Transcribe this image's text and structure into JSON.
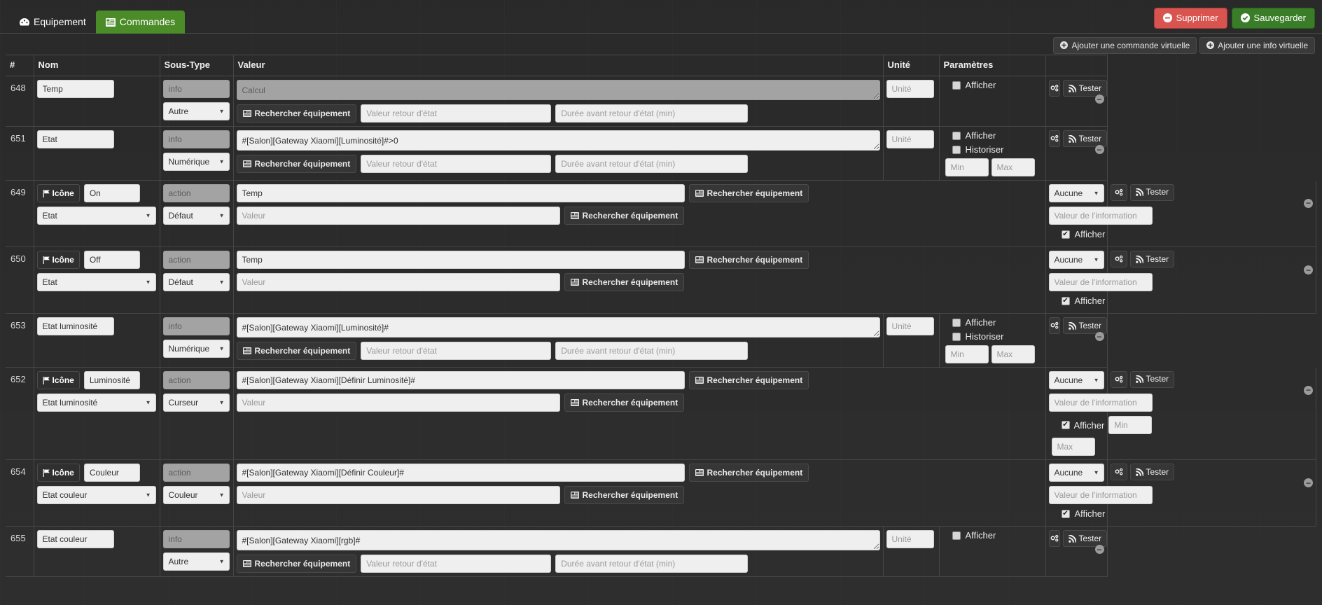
{
  "tabs": [
    {
      "label": "Equipement",
      "icon": "dashboard-icon",
      "active": false
    },
    {
      "label": "Commandes",
      "icon": "list-icon",
      "active": true
    }
  ],
  "toolbar": {
    "delete_label": "Supprimer",
    "save_label": "Sauvegarder",
    "add_virtual_command_label": "Ajouter une commande virtuelle",
    "add_virtual_info_label": "Ajouter une info virtuelle"
  },
  "table": {
    "headers": {
      "id": "#",
      "name": "Nom",
      "subtype": "Sous-Type",
      "value": "Valeur",
      "unit": "Unité",
      "params": "Paramètres",
      "actions": ""
    },
    "common": {
      "search_equipment": "Rechercher équipement",
      "icon_button": "Icône",
      "test_label": "Tester",
      "afficher": "Afficher",
      "historiser": "Historiser",
      "placeholder_unite": "Unité",
      "placeholder_min": "Min",
      "placeholder_max": "Max",
      "placeholder_calcul": "Calcul",
      "placeholder_valeur_retour": "Valeur retour d'état",
      "placeholder_duree": "Durée avant retour d'état (min)",
      "placeholder_valeur": "Valeur",
      "placeholder_valeur_info": "Valeur de l'information"
    },
    "rows": [
      {
        "id": "648",
        "kind": "info",
        "name_value": "Temp",
        "type_badge": "info",
        "subtype_select": "Autre",
        "value_text": "",
        "value_placeholder": "Calcul",
        "value_disabled": true,
        "unit_value": "",
        "afficher_checked": false,
        "historiser": false,
        "minmax": false
      },
      {
        "id": "651",
        "kind": "info",
        "name_value": "Etat",
        "type_badge": "info",
        "subtype_select": "Numérique",
        "value_text": "#[Salon][Gateway Xiaomi][Luminosité]#>0",
        "value_placeholder": "Calcul",
        "value_disabled": false,
        "unit_value": "",
        "afficher_checked": false,
        "historiser": true,
        "historiser_checked": false,
        "minmax": true
      },
      {
        "id": "649",
        "kind": "action",
        "icon_label": "Icône",
        "name_value": "On",
        "type_badge": "action",
        "subtype_select": "Défaut",
        "linked_info_select": "Etat",
        "value_text": "Temp",
        "value_placeholder": "Valeur",
        "param_select": "Aucune",
        "param_info_placeholder": "Valeur de l'information",
        "afficher_checked": true
      },
      {
        "id": "650",
        "kind": "action",
        "icon_label": "Icône",
        "name_value": "Off",
        "type_badge": "action",
        "subtype_select": "Défaut",
        "linked_info_select": "Etat",
        "value_text": "Temp",
        "value_placeholder": "Valeur",
        "param_select": "Aucune",
        "param_info_placeholder": "Valeur de l'information",
        "afficher_checked": true
      },
      {
        "id": "653",
        "kind": "info",
        "name_value": "Etat luminosité",
        "type_badge": "info",
        "subtype_select": "Numérique",
        "value_text": "#[Salon][Gateway Xiaomi][Luminosité]#",
        "value_placeholder": "Calcul",
        "value_disabled": false,
        "unit_value": "",
        "afficher_checked": false,
        "historiser": true,
        "historiser_checked": false,
        "minmax": true
      },
      {
        "id": "652",
        "kind": "action",
        "icon_label": "Icône",
        "name_value": "Luminosité",
        "type_badge": "action",
        "subtype_select": "Curseur",
        "linked_info_select": "Etat luminosité",
        "value_text": "#[Salon][Gateway Xiaomi][Définir Luminosité]#",
        "value_placeholder": "Valeur",
        "param_select": "Aucune",
        "param_info_placeholder": "Valeur de l'information",
        "afficher_checked": true,
        "slider_minmax": true
      },
      {
        "id": "654",
        "kind": "action",
        "icon_label": "Icône",
        "name_value": "Couleur",
        "type_badge": "action",
        "subtype_select": "Couleur",
        "linked_info_select": "Etat couleur",
        "value_text": "#[Salon][Gateway Xiaomi][Définir Couleur]#",
        "value_placeholder": "Valeur",
        "param_select": "Aucune",
        "param_info_placeholder": "Valeur de l'information",
        "afficher_checked": true
      },
      {
        "id": "655",
        "kind": "info",
        "name_value": "Etat couleur",
        "type_badge": "info",
        "subtype_select": "Autre",
        "value_text": "#[Salon][Gateway Xiaomi][rgb]#",
        "value_placeholder": "Calcul",
        "value_disabled": false,
        "unit_value": "",
        "afficher_checked": false,
        "historiser": false,
        "minmax": false
      }
    ]
  },
  "colors": {
    "accent_green": "#4b8b28",
    "danger_red": "#d9534f",
    "save_green": "#3a7d28",
    "background": "#2e2e2e"
  }
}
